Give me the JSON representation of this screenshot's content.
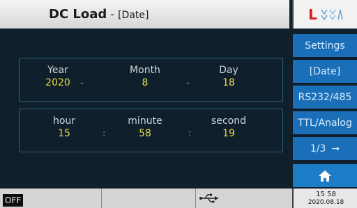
{
  "header": {
    "title": "DC Load",
    "separator": "-",
    "page": "[Date]"
  },
  "logo": {
    "letter": "L",
    "icon": "waveform-icon"
  },
  "date_panel": {
    "year_label": "Year",
    "year_value": "2020",
    "month_label": "Month",
    "month_value": "8",
    "day_label": "Day",
    "day_value": "18",
    "separator": "-"
  },
  "time_panel": {
    "hour_label": "hour",
    "hour_value": "15",
    "minute_label": "minute",
    "minute_value": "58",
    "second_label": "second",
    "second_value": "19",
    "separator": ":"
  },
  "sidebar": {
    "settings": "Settings",
    "date": "[Date]",
    "rs232": "RS232/485",
    "ttl": "TTL/Analog",
    "page": "1/3",
    "page_arrow": "→",
    "home_icon": "home-icon"
  },
  "footer": {
    "output_state": "OFF",
    "usb_icon": "usb-icon",
    "clock_time": "15 58",
    "clock_date": "2020.08.18"
  },
  "colors": {
    "accent_button": "#1b6fb8",
    "value_text": "#e6dc4a",
    "background": "#0f1f2c"
  }
}
